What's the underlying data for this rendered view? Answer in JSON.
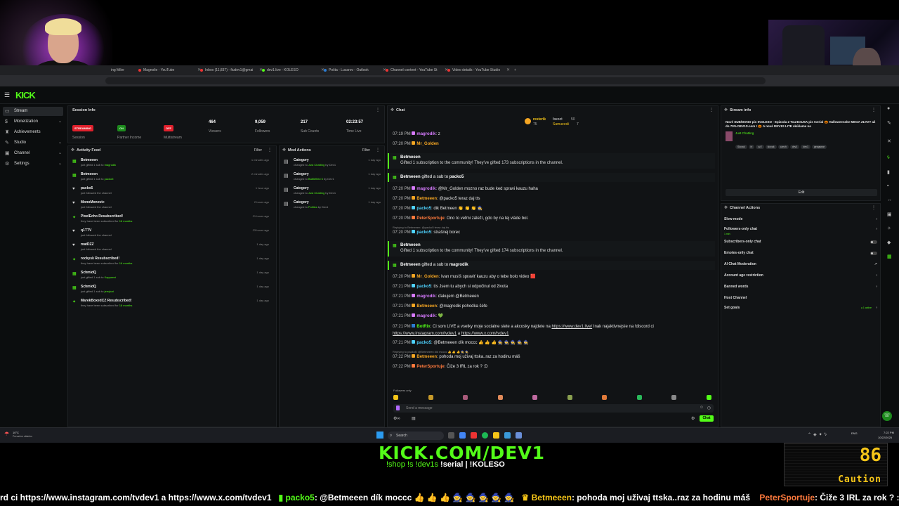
{
  "browser": {
    "tabs": [
      {
        "label": "ing Miler"
      },
      {
        "label": "Magnolie - YouTube"
      },
      {
        "label": "Inbox (11,837) - fiudev1@gmai"
      },
      {
        "label": "dev1.live - KOLESO"
      },
      {
        "label": "Pošta - Lucarov - Outlook"
      },
      {
        "label": "Channel content - YouTube St"
      },
      {
        "label": "Video details - YouTube Studio"
      }
    ]
  },
  "app": {
    "logo": "KICK",
    "sidebar": [
      {
        "label": "Stream",
        "icon": "stream-icon",
        "active": true
      },
      {
        "label": "Monetization",
        "icon": "coin-icon"
      },
      {
        "label": "Achievements",
        "icon": "trophy-icon"
      },
      {
        "label": "Studio",
        "icon": "studio-icon"
      },
      {
        "label": "Channel",
        "icon": "channel-icon"
      },
      {
        "label": "Settings",
        "icon": "gear-icon"
      }
    ],
    "session": {
      "title": "Session Info",
      "stats": [
        {
          "value": "STREAMING",
          "label": "Session"
        },
        {
          "value": "ON",
          "label": "Partner Income"
        },
        {
          "value": "OFF",
          "label": "Multistream"
        },
        {
          "value": "464",
          "label": "Viewers"
        },
        {
          "value": "9,059",
          "label": "Followers"
        },
        {
          "value": "217",
          "label": "Sub Counts"
        },
        {
          "value": "02:23:57",
          "label": "Time Live"
        }
      ]
    },
    "activity": {
      "title": "Activity Feed",
      "filter": "Filter",
      "items": [
        {
          "name": "Betmeeen",
          "desc": "just gifted 1 sub to ",
          "hl": "magrodik",
          "time": "1 minutes ago",
          "icon": "gift-icon"
        },
        {
          "name": "Betmeeen",
          "desc": "just gifted 1 sub to ",
          "hl": "packo5",
          "time": "2 minutes ago",
          "icon": "gift-icon"
        },
        {
          "name": "packo5",
          "desc": "just followed the channel",
          "hl": "",
          "time": "1 hour ago",
          "icon": "heart-icon"
        },
        {
          "name": "MonoMonovic",
          "desc": "just followed the channel",
          "hl": "",
          "time": "2 hours ago",
          "icon": "heart-icon"
        },
        {
          "name": "PixelEcho Resubscribed!",
          "desc": "they have been subscribed for ",
          "hl": "16 months",
          "time": "21 hours ago",
          "icon": "star-icon"
        },
        {
          "name": "q1TTV",
          "desc": "just followed the channel",
          "hl": "",
          "time": "23 hours ago",
          "icon": "heart-icon"
        },
        {
          "name": "matDZZ",
          "desc": "just followed the channel",
          "hl": "",
          "time": "1 day ago",
          "icon": "heart-icon"
        },
        {
          "name": "rockysk Resubscribed!",
          "desc": "they have been subscribed for ",
          "hl": "16 months",
          "time": "1 day ago",
          "icon": "star-icon"
        },
        {
          "name": "SchmidQ",
          "desc": "just gifted 1 sub to ",
          "hl": "Kappanxi",
          "time": "1 day ago",
          "icon": "gift-icon"
        },
        {
          "name": "SchmidQ",
          "desc": "just gifted 1 sub to ",
          "hl": "jerrykat",
          "time": "1 day ago",
          "icon": "gift-icon"
        },
        {
          "name": "MarekBoxedCZ Resubscribed!",
          "desc": "they have been subscribed for ",
          "hl": "18 months",
          "time": "1 day ago",
          "icon": "star-icon"
        }
      ]
    },
    "mod": {
      "title": "Mod Actions",
      "filter": "Filter",
      "items": [
        {
          "name": "Category",
          "desc": "changed to ",
          "hl": "Just Chatting",
          "by": " by Dev1",
          "time": "1 day ago"
        },
        {
          "name": "Category",
          "desc": "changed to ",
          "hl": "Battlefield 6",
          "by": " by Dev1",
          "time": "1 day ago"
        },
        {
          "name": "Category",
          "desc": "changed to ",
          "hl": "Just Chatting",
          "by": " by Dev1",
          "time": "1 day ago"
        },
        {
          "name": "Category",
          "desc": "changed to ",
          "hl": "Politics",
          "by": " by Dev1",
          "time": "1 day ago"
        }
      ]
    },
    "chat": {
      "title": "Chat",
      "pinned_top": {
        "user1": "resterik",
        "val1": "75",
        "user2": "faxoot",
        "val2": "50",
        "user3": "Samueesli",
        "val3": "7"
      },
      "lines": [
        {
          "time": "07:19 PM",
          "user": "magrodik",
          "color": "#d77bff",
          "msg": ": z"
        },
        {
          "time": "07:20 PM",
          "user": "Mr_Golden",
          "color": "#f5a623",
          "msg": ""
        }
      ],
      "gift1": {
        "name": "Betmeeen",
        "desc": "Gifted 1 subscription to the community! They've gifted 173 subscriptions in the channel."
      },
      "gift_sub1": {
        "name": "Betmeeen",
        "mid": " gifted a sub to ",
        "target": "packo5"
      },
      "lines2": [
        {
          "time": "07:20 PM",
          "user": "magrodik",
          "color": "#d77bff",
          "msg": ": @Mr_Golden mozno raz bude ked spravi kauzu haha"
        },
        {
          "time": "07:20 PM",
          "user": "Betmeeen",
          "color": "#f5a623",
          "msg": ": @packo5 teraz daj tts"
        },
        {
          "time": "07:20 PM",
          "user": "packo5",
          "color": "#4fd3ff",
          "msg": ": dik Betmeen 👏 👏 👏 🧙"
        },
        {
          "time": "07:20 PM",
          "user": "PeterSportuje",
          "color": "#ff7a3d",
          "msg": ": Ono to veľmi záleží, gdo by na tej vláde bol."
        }
      ],
      "reply1": "Replying to Betmeeen: @packo5 teraz daj tts",
      "line_reply1": {
        "time": "07:20 PM",
        "user": "packo5",
        "color": "#4fd3ff",
        "msg": ": strašnej borec"
      },
      "gift2": {
        "name": "Betmeeen",
        "desc": "Gifted 1 subscription to the community! They've gifted 174 subscriptions in the channel."
      },
      "gift_sub2": {
        "name": "Betmeeen",
        "mid": " gifted a sub to ",
        "target": "magrodik"
      },
      "lines3": [
        {
          "time": "07:20 PM",
          "user": "Mr_Golden",
          "color": "#f5a623",
          "msg": ": Ivan musíš spraviť kauzu aby o tebe bolo video 🟥"
        },
        {
          "time": "07:21 PM",
          "user": "packo5",
          "color": "#4fd3ff",
          "msg": ": tts Jsem tu abych si odpočinul od života"
        },
        {
          "time": "07:21 PM",
          "user": "magrodik",
          "color": "#d77bff",
          "msg": ": ďakujem @Betmeeen"
        },
        {
          "time": "07:21 PM",
          "user": "Betmeeen",
          "color": "#f5a623",
          "msg": ": @magrodik pohodka šéfe"
        },
        {
          "time": "07:21 PM",
          "user": "magrodik",
          "color": "#d77bff",
          "msg": ": 💚"
        }
      ],
      "botrix": {
        "time": "07:21 PM",
        "user": "BotRix",
        "color": "#53fc18",
        "msg": ": Ci som LIVE a vsetky moje socialne siete a akcosky najdete na ",
        "link1": "https://www.dev1.live/",
        "mid": " Inak najaktivnejsie na !discord ci",
        "link2": "https://www.instagram.com/tvdev1",
        "and": " a ",
        "link3": "https://www.x.com/tvdev1"
      },
      "lines4": [
        {
          "time": "07:21 PM",
          "user": "packo5",
          "color": "#4fd3ff",
          "msg": ": @Betmeeen dík moccc 👍 👍 👍 🧙 🧙 🧙 🧙 🧙"
        }
      ],
      "reply2": "Replying to packo5: @Betmeeen dík moccc 👍 👍 👍 🧙 🧙",
      "lines5": [
        {
          "time": "07:22 PM",
          "user": "Betmeeen",
          "color": "#f5a623",
          "msg": ": pohoda moj uživaj ttska..raz za hodinu máš"
        },
        {
          "time": "07:22 PM",
          "user": "PeterSportuje",
          "color": "#ff7a3d",
          "msg": ": Čiže 3 IRL za rok ? :D"
        }
      ],
      "followers_only": "Followers only",
      "placeholder": "Send a message",
      "send": "Chat"
    },
    "stream_info": {
      "title": "Stream info",
      "text": "Nové SUB/DONO pis !KOLESO - Epizoda 2 TourDeUSA pis !serial 🎃 Halloweenske MEGA ZĽAVY až do 70% DEV1S.com ! 🎃 A nové DEV1S LITE skúšame na",
      "category": "Just Chatting",
      "tags": [
        "Slovak",
        "irl",
        "cz2",
        "slovak",
        "czech",
        "dev1",
        "dev1",
        "gesgwear"
      ],
      "edit": "Edit"
    },
    "channel_actions": {
      "title": "Channel Actions",
      "items": [
        {
          "label": "Slow mode",
          "kind": "chevron",
          "sub": ""
        },
        {
          "label": "Followers-only chat",
          "kind": "chevron",
          "sub": "1 min"
        },
        {
          "label": "Subscribers-only chat",
          "kind": "toggle",
          "sub": ""
        },
        {
          "label": "Emotes-only chat",
          "kind": "toggle",
          "sub": ""
        },
        {
          "label": "AI Chat Moderation",
          "kind": "link",
          "sub": ""
        },
        {
          "label": "Account age restriction",
          "kind": "chevron",
          "sub": ""
        },
        {
          "label": "Banned words",
          "kind": "chevron",
          "sub": ""
        },
        {
          "label": "Host Channel",
          "kind": "none",
          "sub": ""
        },
        {
          "label": "Set goals",
          "kind": "chevron",
          "sub": "● 1 active"
        }
      ]
    }
  },
  "taskbar": {
    "search": "Search",
    "weather": "10°C",
    "weather_sub": "Prevažne oblačno",
    "lang": "ENG",
    "clock": "7:22 PM",
    "date": "10/22/2025"
  },
  "overlay": {
    "url": "KICK.COM/DEV1",
    "sub1": "!shop !s !dev1s",
    "sub2": " !serial | !KOLESO",
    "caution_value": "86",
    "caution_label": "Caution",
    "ticker_a": "rd ci https://www.instagram.com/tvdev1 a https://www.x.com/tvdev1",
    "ticker_user1": "packo5",
    "ticker_msg1": ": @Betmeeen dík moccc 👍 👍 👍 🧙 🧙 🧙 🧙 🧙",
    "ticker_user2": "Betmeeen",
    "ticker_msg2": ": pohoda moj uživaj ttska..raz za hodinu máš",
    "ticker_user3": "PeterSportuje",
    "ticker_msg3": ": Čiže 3 IRL za rok ? :D"
  }
}
